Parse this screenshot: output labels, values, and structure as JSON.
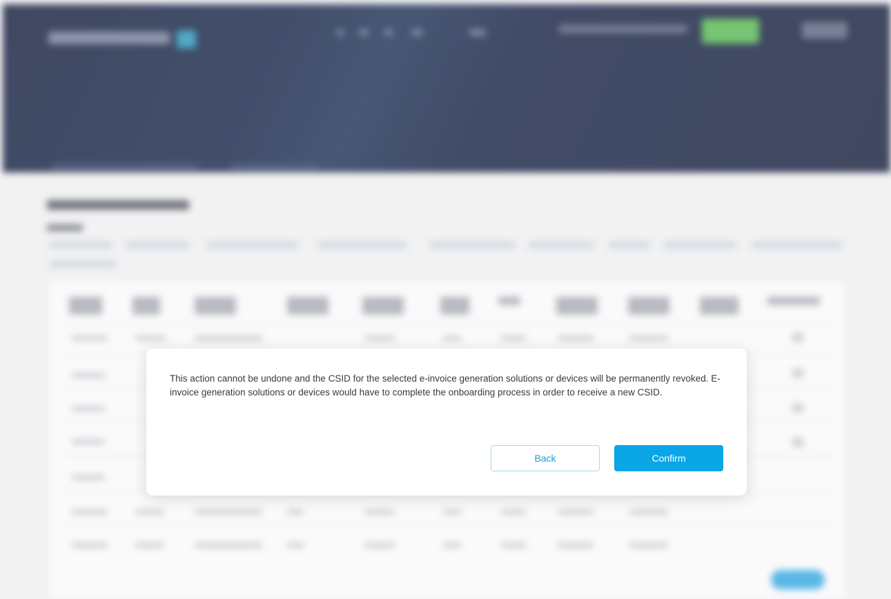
{
  "modal": {
    "message": "This action cannot be undone and the CSID for the selected e-invoice generation solutions or devices will be permanently revoked. E-invoice generation solutions or devices would have to complete the onboarding process in order to receive a new CSID.",
    "back_label": "Back",
    "confirm_label": "Confirm"
  },
  "colors": {
    "header_bg": "#0a1a3f",
    "login_green": "#4fb848",
    "accent_blue": "#0aa6e6",
    "back_border": "#a8d9ef"
  }
}
